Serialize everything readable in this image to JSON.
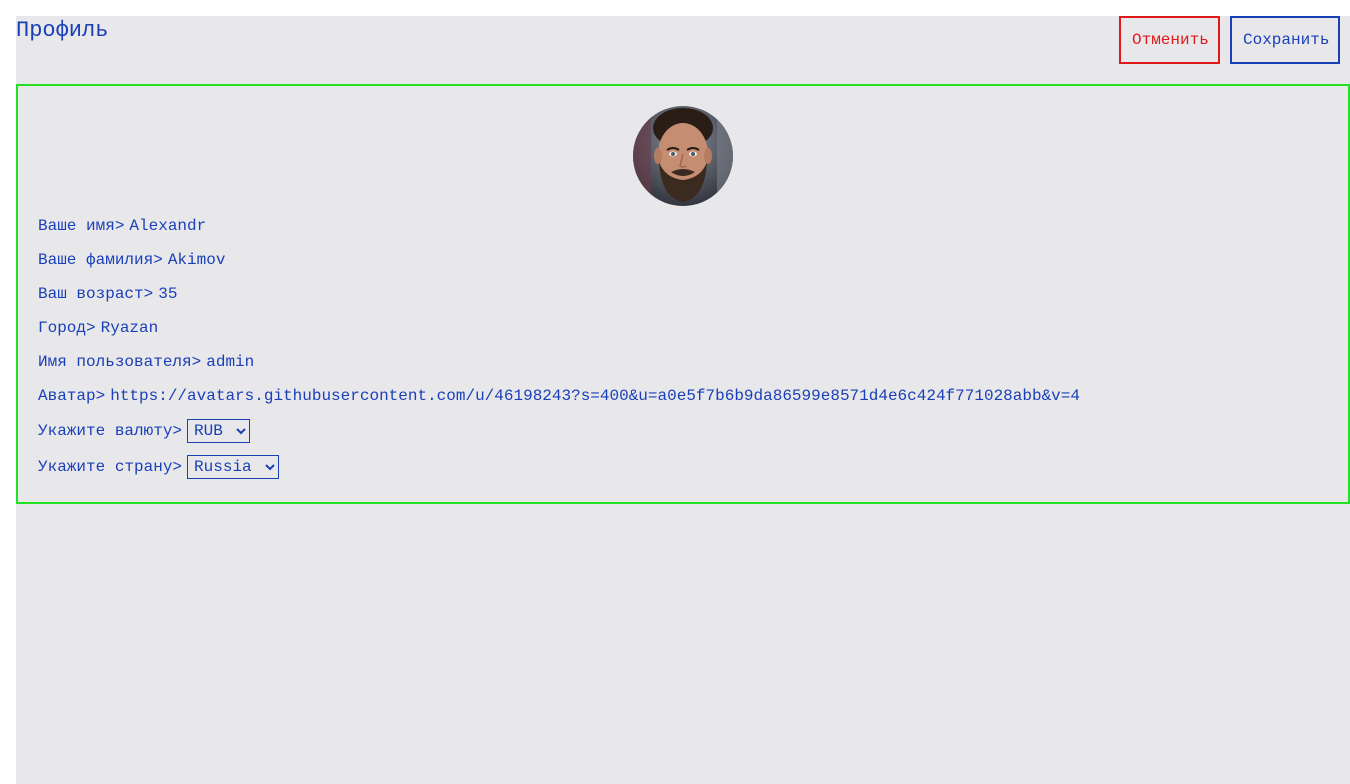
{
  "header": {
    "title": "Профиль",
    "cancel_label": "Отменить",
    "save_label": "Сохранить"
  },
  "colors": {
    "text": "#1a3fb8",
    "cancel": "#e0191b",
    "card_border": "#22e022",
    "background": "#e8e8eb"
  },
  "profile": {
    "first_name_label": "Ваше имя>",
    "first_name": "Alexandr",
    "last_name_label": "Ваше фамилия>",
    "last_name": "Akimov",
    "age_label": "Ваш возраст>",
    "age": "35",
    "city_label": "Город>",
    "city": "Ryazan",
    "username_label": "Имя пользователя>",
    "username": "admin",
    "avatar_label": "Аватар>",
    "avatar": "https://avatars.githubusercontent.com/u/46198243?s=400&u=a0e5f7b6b9da86599e8571d4e6c424f771028abb&v=4",
    "currency_label": "Укажите валюту>",
    "currency": "RUB",
    "country_label": "Укажите страну>",
    "country": "Russia"
  }
}
